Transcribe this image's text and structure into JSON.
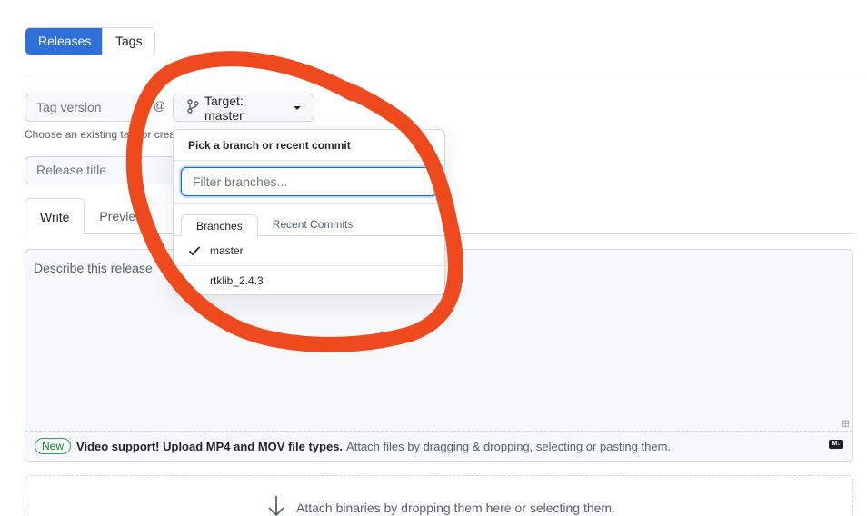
{
  "view_toggle": {
    "releases_label": "Releases",
    "tags_label": "Tags"
  },
  "tag_input": {
    "placeholder": "Tag version"
  },
  "at_sign": "@",
  "target_button": {
    "label": "Target: master"
  },
  "helper_text": "Choose an existing tag, or creat",
  "release_title_input": {
    "placeholder": "Release title"
  },
  "editor_tabs": {
    "write": "Write",
    "preview": "Preview"
  },
  "editor": {
    "placeholder": "Describe this release",
    "new_badge": "New",
    "video_support": "Video support! Upload MP4 and MOV file types.",
    "attach_hint": "Attach files by dragging & dropping, selecting or pasting them.",
    "markdown_icon": "markdown-icon"
  },
  "attach_binaries": "Attach binaries by dropping them here or selecting them.",
  "branch_dropdown": {
    "header": "Pick a branch or recent commit",
    "filter_placeholder": "Filter branches...",
    "tabs": [
      "Branches",
      "Recent Commits"
    ],
    "items": [
      {
        "name": "master",
        "selected": true
      },
      {
        "name": "rtklib_2.4.3",
        "selected": false
      }
    ]
  },
  "colors": {
    "primary": "#2e6fd8",
    "accent_border": "#0969da",
    "annotation": "#ee4a1e",
    "new_badge": "#1a7f37"
  },
  "icons": {
    "target": "git-branch-icon",
    "check": "check-icon",
    "attach": "arrow-down-icon"
  }
}
